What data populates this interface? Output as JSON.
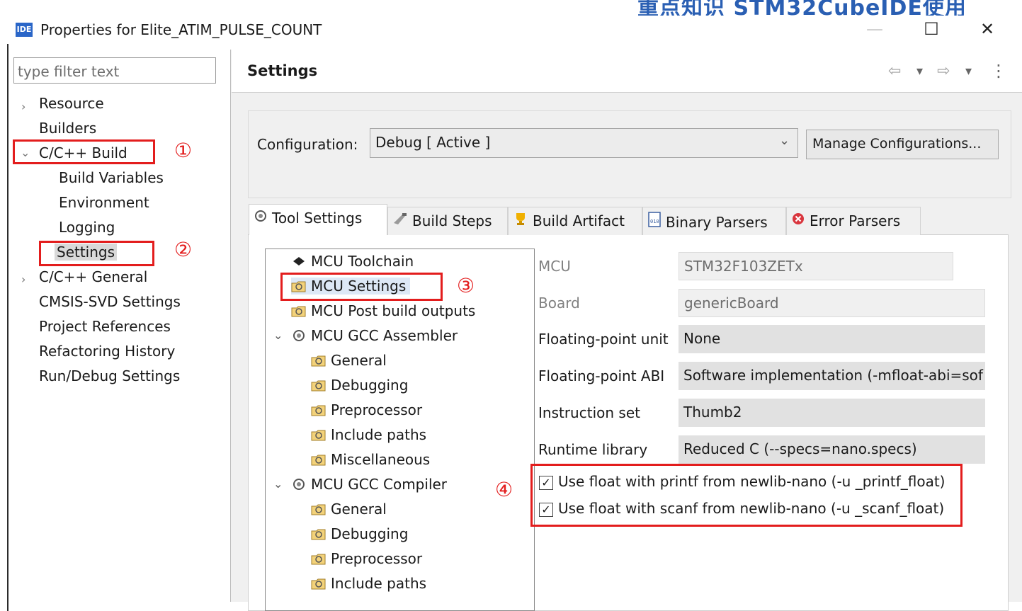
{
  "banner": "重点知识 STM32CubeIDE使用",
  "window": {
    "icon_label": "IDE",
    "title": "Properties for Elite_ATIM_PULSE_COUNT",
    "minimize": "—",
    "maximize": "☐",
    "close": "✕"
  },
  "filter": {
    "placeholder": "type filter text"
  },
  "nav": {
    "resource": "Resource",
    "builders": "Builders",
    "cpp_build": "C/C++ Build",
    "build_variables": "Build Variables",
    "environment": "Environment",
    "logging": "Logging",
    "settings": "Settings",
    "cpp_general": "C/C++ General",
    "cmsis_svd": "CMSIS-SVD Settings",
    "project_references": "Project References",
    "refactoring_history": "Refactoring History",
    "run_debug": "Run/Debug Settings"
  },
  "annotations": {
    "one": "①",
    "two": "②",
    "three": "③",
    "four": "④"
  },
  "header": {
    "title": "Settings",
    "back_icon": "⇦",
    "drop_icon": "▾",
    "forward_icon": "⇨",
    "menu_icon": "⋮"
  },
  "configuration": {
    "label": "Configuration:",
    "value": "Debug  [ Active ]",
    "dropdown_icon": "⌄",
    "manage_button": "Manage Configurations..."
  },
  "tabs": {
    "tool_settings": "Tool Settings",
    "build_steps": "Build Steps",
    "build_artifact": "Build Artifact",
    "binary_parsers": "Binary Parsers",
    "error_parsers": "Error Parsers"
  },
  "tool_tree": {
    "mcu_toolchain": "MCU Toolchain",
    "mcu_settings": "MCU Settings",
    "mcu_post_build": "MCU Post build outputs",
    "gcc_assembler": "MCU GCC Assembler",
    "asm_general": "General",
    "asm_debugging": "Debugging",
    "asm_preprocessor": "Preprocessor",
    "asm_include_paths": "Include paths",
    "asm_misc": "Miscellaneous",
    "gcc_compiler": "MCU GCC Compiler",
    "cc_general": "General",
    "cc_debugging": "Debugging",
    "cc_preprocessor": "Preprocessor",
    "cc_include_paths": "Include paths"
  },
  "mcu_props": {
    "mcu_label": "MCU",
    "mcu_value": "STM32F103ZETx",
    "board_label": "Board",
    "board_value": "genericBoard",
    "fpu_label": "Floating-point unit",
    "fpu_value": "None",
    "fpabi_label": "Floating-point ABI",
    "fpabi_value": "Software implementation (-mfloat-abi=sof",
    "iset_label": "Instruction set",
    "iset_value": "Thumb2",
    "runtime_label": "Runtime library",
    "runtime_value": "Reduced C (--specs=nano.specs)",
    "printf_float": "Use float with printf from newlib-nano (-u _printf_float)",
    "scanf_float": "Use float with scanf from newlib-nano (-u _scanf_float)",
    "printf_checked": true,
    "scanf_checked": true,
    "check_mark": "✓"
  }
}
